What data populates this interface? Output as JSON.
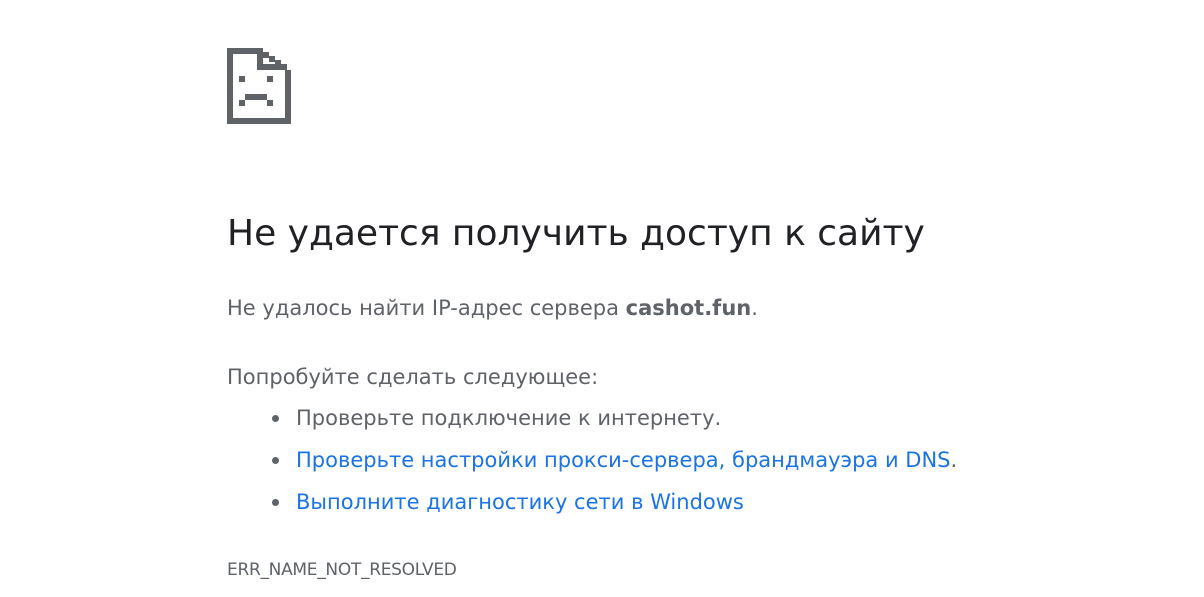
{
  "error_page": {
    "icon": "sad-page-icon",
    "heading": "Не удается получить доступ к сайту",
    "summary_prefix": "Не удалось найти IP-адрес сервера ",
    "host": "cashot.fun",
    "summary_suffix": ".",
    "suggestions_title": "Попробуйте сделать следующее:",
    "suggestions": [
      {
        "text": "Проверьте подключение к интернету.",
        "is_link": false
      },
      {
        "text": "Проверьте настройки прокси-сервера, брандмауэра и DNS",
        "suffix": ".",
        "is_link": true
      },
      {
        "text": "Выполните диагностику сети в Windows",
        "is_link": true
      }
    ],
    "error_code": "ERR_NAME_NOT_RESOLVED"
  },
  "colors": {
    "heading": "#202124",
    "body_text": "#5f6368",
    "link": "#1a73e8",
    "icon": "#5f6368"
  }
}
